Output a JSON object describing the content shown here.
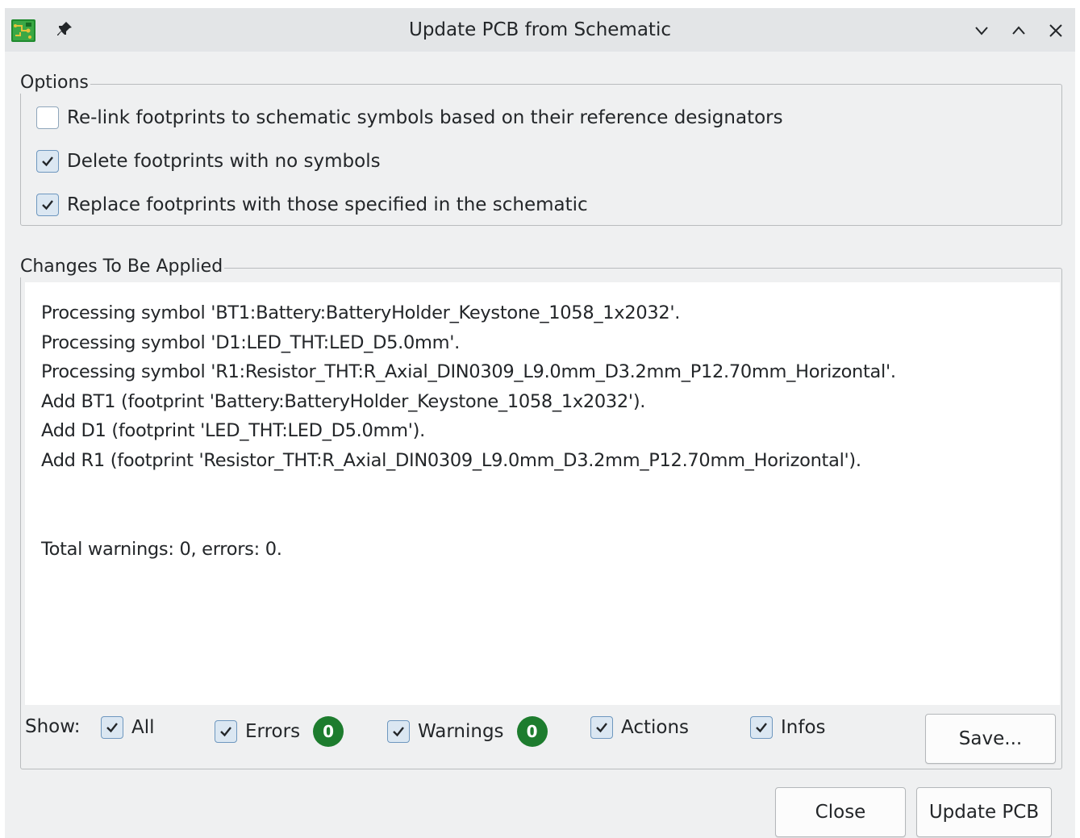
{
  "window": {
    "title": "Update PCB from Schematic",
    "icons": {
      "app": "kicad-pcb-icon",
      "pin": "pin-icon",
      "minimize": "chevron-down-icon",
      "maximize": "chevron-up-icon",
      "close": "close-icon"
    }
  },
  "options": {
    "title": "Options",
    "items": [
      {
        "label": "Re-link footprints to schematic symbols based on their reference designators",
        "checked": false
      },
      {
        "label": "Delete footprints with no symbols",
        "checked": true
      },
      {
        "label": "Replace footprints with those specified in the schematic",
        "checked": true
      }
    ]
  },
  "changes": {
    "title": "Changes To Be Applied",
    "log": [
      "Processing symbol 'BT1:Battery:BatteryHolder_Keystone_1058_1x2032'.",
      "Processing symbol 'D1:LED_THT:LED_D5.0mm'.",
      "Processing symbol 'R1:Resistor_THT:R_Axial_DIN0309_L9.0mm_D3.2mm_P12.70mm_Horizontal'.",
      "Add BT1 (footprint 'Battery:BatteryHolder_Keystone_1058_1x2032').",
      "Add D1 (footprint 'LED_THT:LED_D5.0mm').",
      "Add R1 (footprint 'Resistor_THT:R_Axial_DIN0309_L9.0mm_D3.2mm_P12.70mm_Horizontal')."
    ],
    "summary": "Total warnings: 0, errors: 0."
  },
  "filters": {
    "show_label": "Show:",
    "all": {
      "label": "All",
      "checked": true
    },
    "errors": {
      "label": "Errors",
      "checked": true,
      "count": "0"
    },
    "warnings": {
      "label": "Warnings",
      "checked": true,
      "count": "0"
    },
    "actions": {
      "label": "Actions",
      "checked": true
    },
    "infos": {
      "label": "Infos",
      "checked": true
    },
    "save_label": "Save..."
  },
  "buttons": {
    "close": "Close",
    "update": "Update PCB"
  },
  "colors": {
    "badge": "#1d7c2e",
    "accent": "#6e97bf",
    "window_bg": "#eff0f1"
  }
}
